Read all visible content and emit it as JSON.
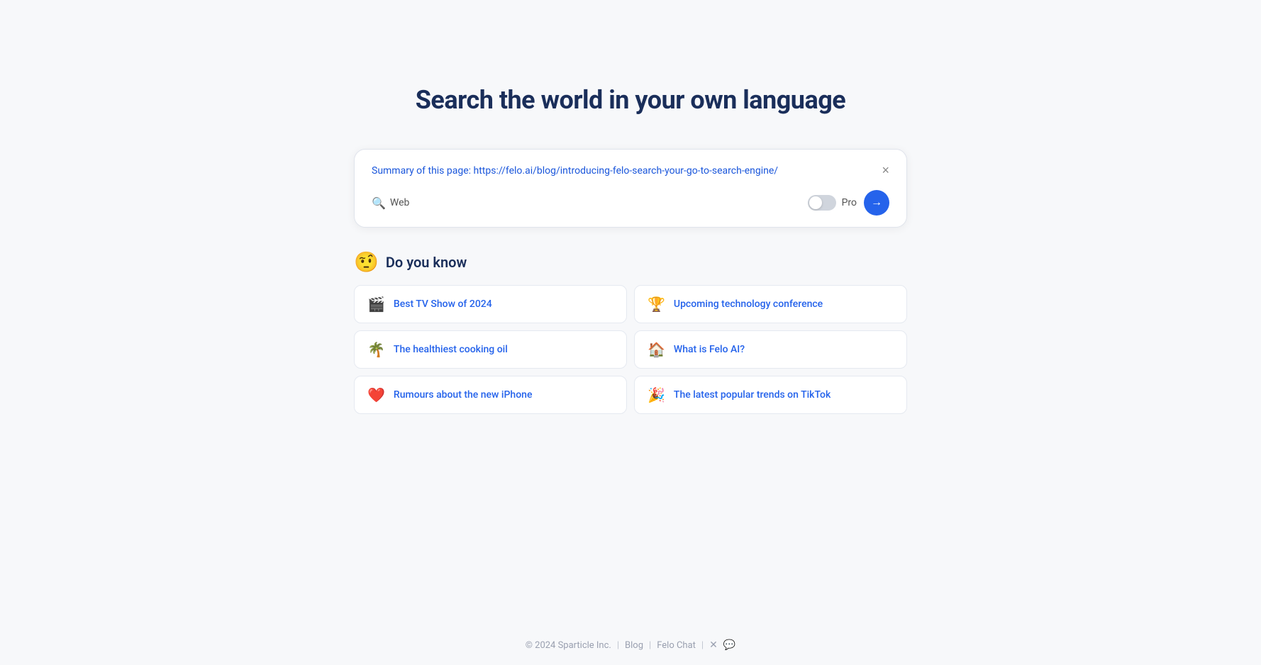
{
  "page": {
    "title": "Search the world in your own language"
  },
  "search_box": {
    "url_prefix": "Summary of this page: ",
    "url": "https://felo.ai/blog/introducing-felo-search-your-go-to-search-engine/",
    "mode_label": "Web",
    "pro_label": "Pro",
    "close_label": "×",
    "submit_arrow": "→"
  },
  "do_you_know": {
    "emoji": "🤨",
    "title": "Do you know",
    "suggestions": [
      {
        "id": "tv-show",
        "emoji": "🎬",
        "text": "Best TV Show of 2024"
      },
      {
        "id": "tech-conference",
        "emoji": "🏆",
        "text": "Upcoming technology conference"
      },
      {
        "id": "cooking-oil",
        "emoji": "🌴",
        "text": "The healthiest cooking oil"
      },
      {
        "id": "felo-ai",
        "emoji": "🏠",
        "text": "What is Felo AI?"
      },
      {
        "id": "iphone",
        "emoji": "❤️",
        "text": "Rumours about the new iPhone"
      },
      {
        "id": "tiktok",
        "emoji": "🎉",
        "text": "The latest popular trends on TikTok"
      }
    ]
  },
  "footer": {
    "copyright": "© 2024 Sparticle Inc.",
    "links": [
      {
        "id": "blog",
        "label": "Blog"
      },
      {
        "id": "felo-chat",
        "label": "Felo Chat"
      }
    ]
  }
}
